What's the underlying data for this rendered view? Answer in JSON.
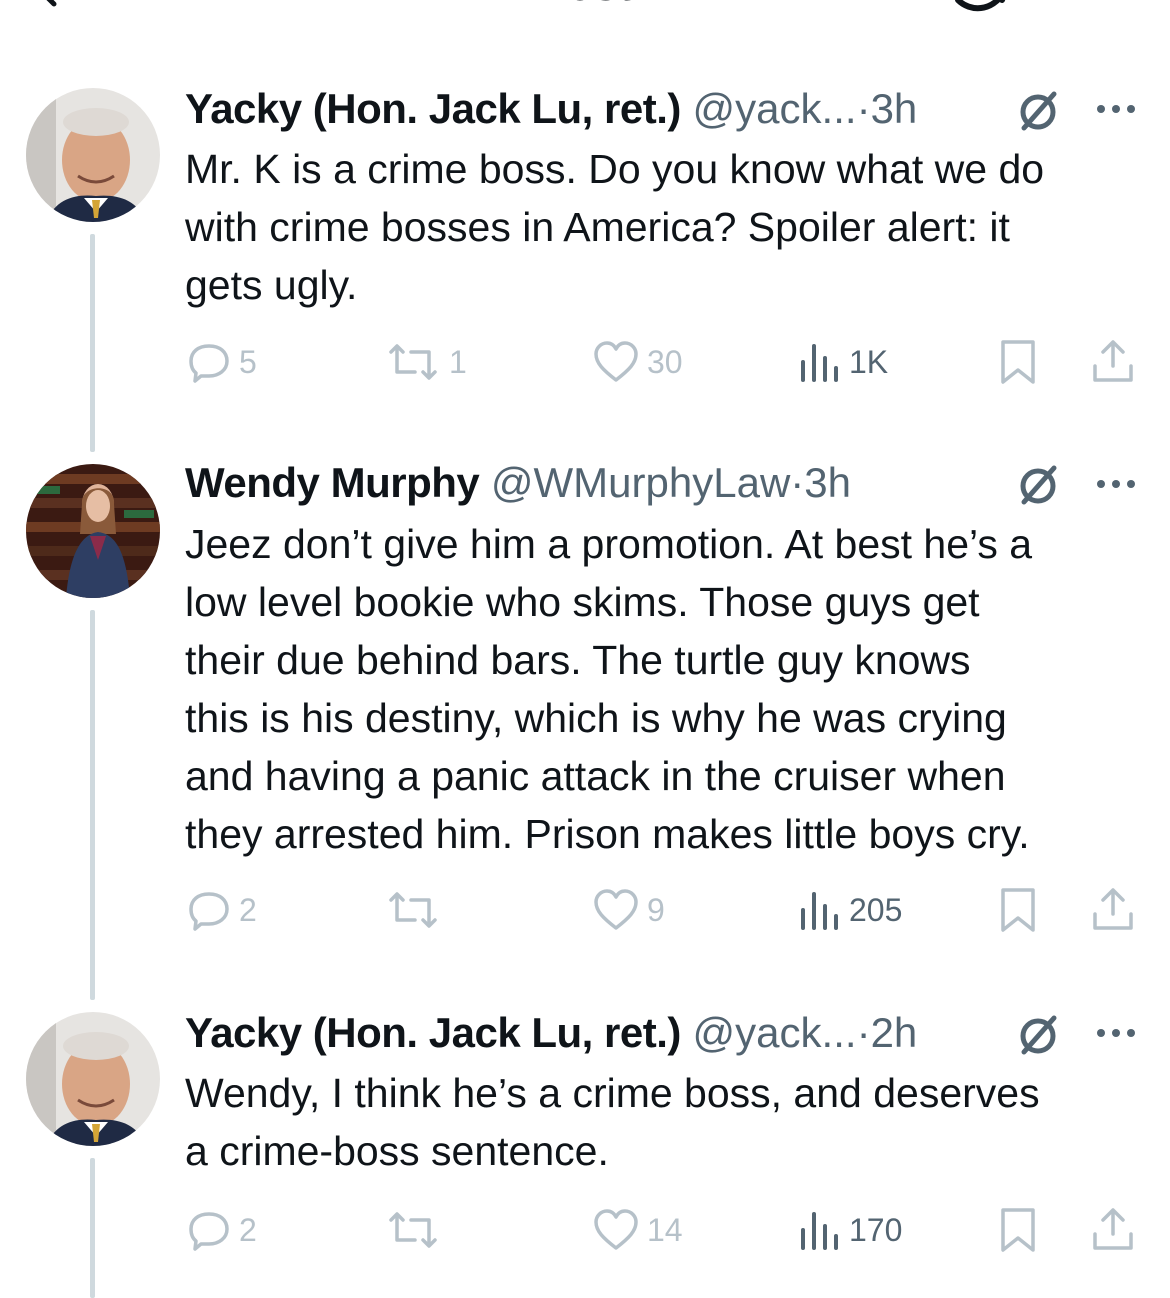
{
  "header": {
    "title": "Post"
  },
  "tweets": [
    {
      "name": "Yacky (Hon. Jack Lu, ret.)",
      "handle": "@yack...",
      "sep": "·",
      "time": "3h",
      "text": "Mr. K is a crime boss.  Do you know what we do\nwith crime bosses in America?  Spoiler alert: it\ngets ugly.",
      "replies": "5",
      "reposts": "1",
      "likes": "30",
      "views": "1K"
    },
    {
      "name": "Wendy Murphy",
      "handle": "@WMurphyLaw",
      "sep": "·",
      "time": "3h",
      "text": "Jeez don’t give him a promotion. At best he’s a\nlow level bookie who skims. Those guys get\ntheir due behind bars. The turtle guy knows\nthis is his destiny, which is why he was crying\nand having a panic attack in the cruiser when\nthey arrested him. Prison makes little boys cry.",
      "replies": "2",
      "reposts": "",
      "likes": "9",
      "views": "205"
    },
    {
      "name": "Yacky (Hon. Jack Lu, ret.)",
      "handle": "@yack...",
      "sep": "·",
      "time": "2h",
      "text": "Wendy, I think he’s a crime boss, and deserves\na crime-boss sentence.",
      "replies": "2",
      "reposts": "",
      "likes": "14",
      "views": "170"
    }
  ],
  "colors": {
    "text": "#0f1419",
    "secondary": "#536471",
    "muted_action": "#b6c1c9",
    "thread_line": "#cfd9de"
  }
}
